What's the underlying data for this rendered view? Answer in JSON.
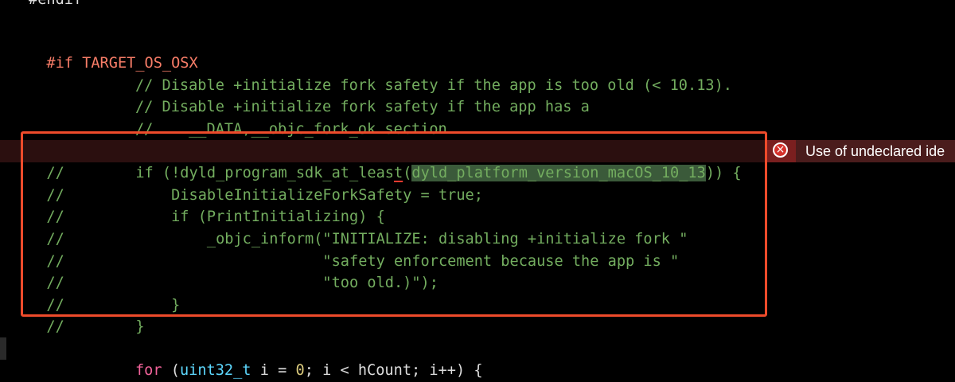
{
  "error": {
    "message": "Use of undeclared ide",
    "icon": "error-circle-icon",
    "color": "#ff3b30"
  },
  "code": {
    "line_top": "#endif",
    "line_if": "#if TARGET_OS_OSX",
    "comment1": "        // Disable +initialize fork safety if the app is too old (< 10.13).",
    "comment2": "        // Disable +initialize fork safety if the app has a",
    "comment3": "        //    __DATA,__objc_fork_ok section.",
    "sel1_prefix": "//",
    "sel1_a": "        if (!dyld_program_sdk_at_leas",
    "sel1_err": "t",
    "sel1_b": "(",
    "sel1_hl": "dyld_platform_version_macOS_10_13",
    "sel1_c": ")) {",
    "sel2": "//            DisableInitializeForkSafety = true;",
    "sel3": "//            if (PrintInitializing) {",
    "sel4": "//                _objc_inform(\"INITIALIZE: disabling +initialize fork \"",
    "sel5": "//                             \"safety enforcement because the app is \"",
    "sel6": "//                             \"too old.)\");",
    "sel7": "//            }",
    "sel8": "//        }",
    "for_indent": "        ",
    "for_kw": "for",
    "for_paren": " (",
    "for_type": "uint32_t",
    "for_a": " i = ",
    "for_num": "0",
    "for_b": "; i < hCount; i++) {"
  },
  "colors": {
    "comment": "#73ad5f",
    "keyword": "#f2639a",
    "type": "#5dd8ff",
    "number": "#d9c97c",
    "directive": "#f87d68",
    "selection_border": "#ee4b2b"
  }
}
